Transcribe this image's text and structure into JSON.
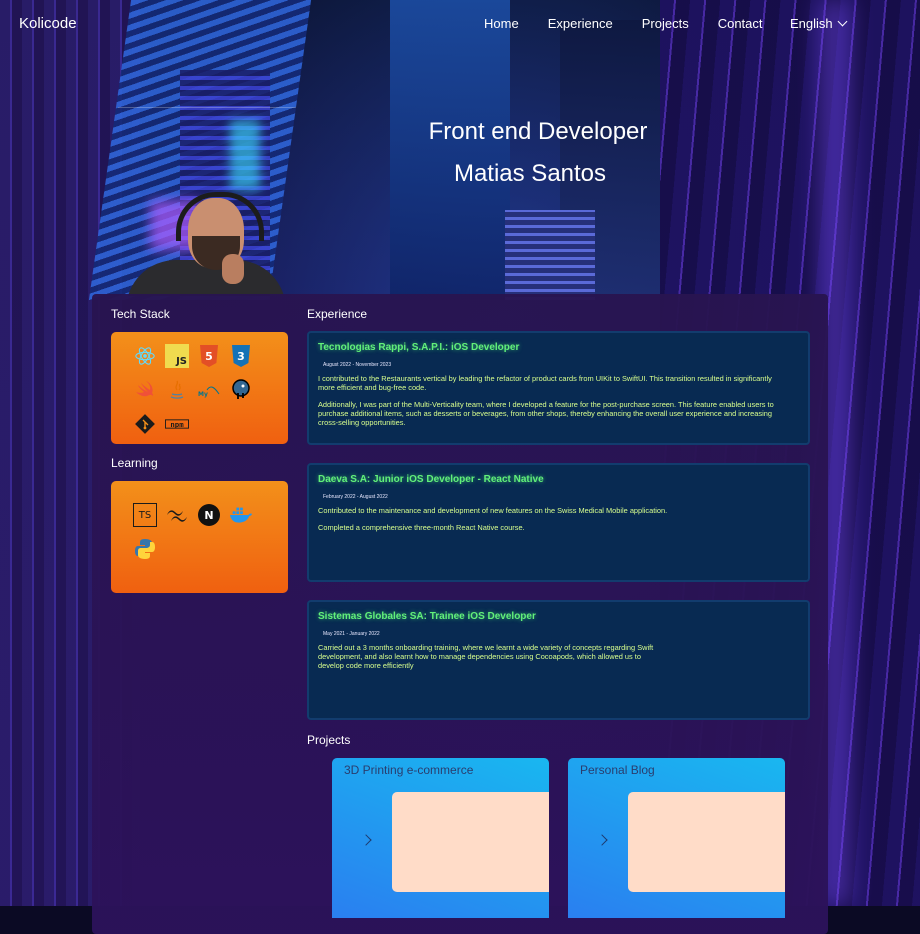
{
  "nav": {
    "logo": "Kolicode",
    "links": [
      "Home",
      "Experience",
      "Projects",
      "Contact"
    ],
    "language": "English"
  },
  "hero": {
    "title": "Front end Developer",
    "name": "Matias Santos"
  },
  "sections": {
    "tech_stack": "Tech Stack",
    "learning": "Learning",
    "experience": "Experience",
    "projects": "Projects"
  },
  "tech_stack_icons": [
    "react-icon",
    "javascript-icon",
    "html5-icon",
    "css3-icon",
    "swift-icon",
    "java-icon",
    "mysql-icon",
    "postgresql-icon",
    "git-icon",
    "npm-icon"
  ],
  "learning_icons": [
    "typescript-icon",
    "tailwind-icon",
    "nextjs-icon",
    "docker-icon",
    "python-icon"
  ],
  "experience": [
    {
      "title": "Tecnologias Rappi, S.A.P.I.: iOS Developer",
      "date": "August 2022 - November 2023",
      "paragraphs": [
        "I contributed to the Restaurants vertical by leading the refactor of product cards from UIKit to SwiftUI. This transition resulted in significantly more efficient and bug-free code.",
        "Additionally, I was part of the Multi-Verticality team, where I developed a feature for the post-purchase screen. This feature enabled users to purchase additional items, such as desserts or beverages, from other shops, thereby enhancing the overall user experience and increasing cross-selling opportunities."
      ]
    },
    {
      "title": "Daeva S.A: Junior iOS Developer - React Native",
      "date": "February 2022 - August 2022",
      "paragraphs": [
        "Contributed to the maintenance and development of new features on the Swiss Medical Mobile application.",
        "Completed a comprehensive three-month React Native course."
      ]
    },
    {
      "title": "Sistemas Globales SA: Trainee iOS Developer",
      "date": "May 2021 - January 2022",
      "paragraphs": [
        "Carried out a 3 months onboarding training, where we learnt a wide variety of concepts regarding Swift development, and also learnt how to manage dependencies using Cocoapods, which allowed us to develop code more efficiently"
      ]
    }
  ],
  "projects": [
    {
      "title": "3D Printing e-commerce"
    },
    {
      "title": "Personal Blog"
    }
  ],
  "colors": {
    "accent_green": "#62f07a",
    "tile_orange": "#f3901a",
    "card_blue": "#082a52",
    "project_blue": "#19b7f0"
  }
}
